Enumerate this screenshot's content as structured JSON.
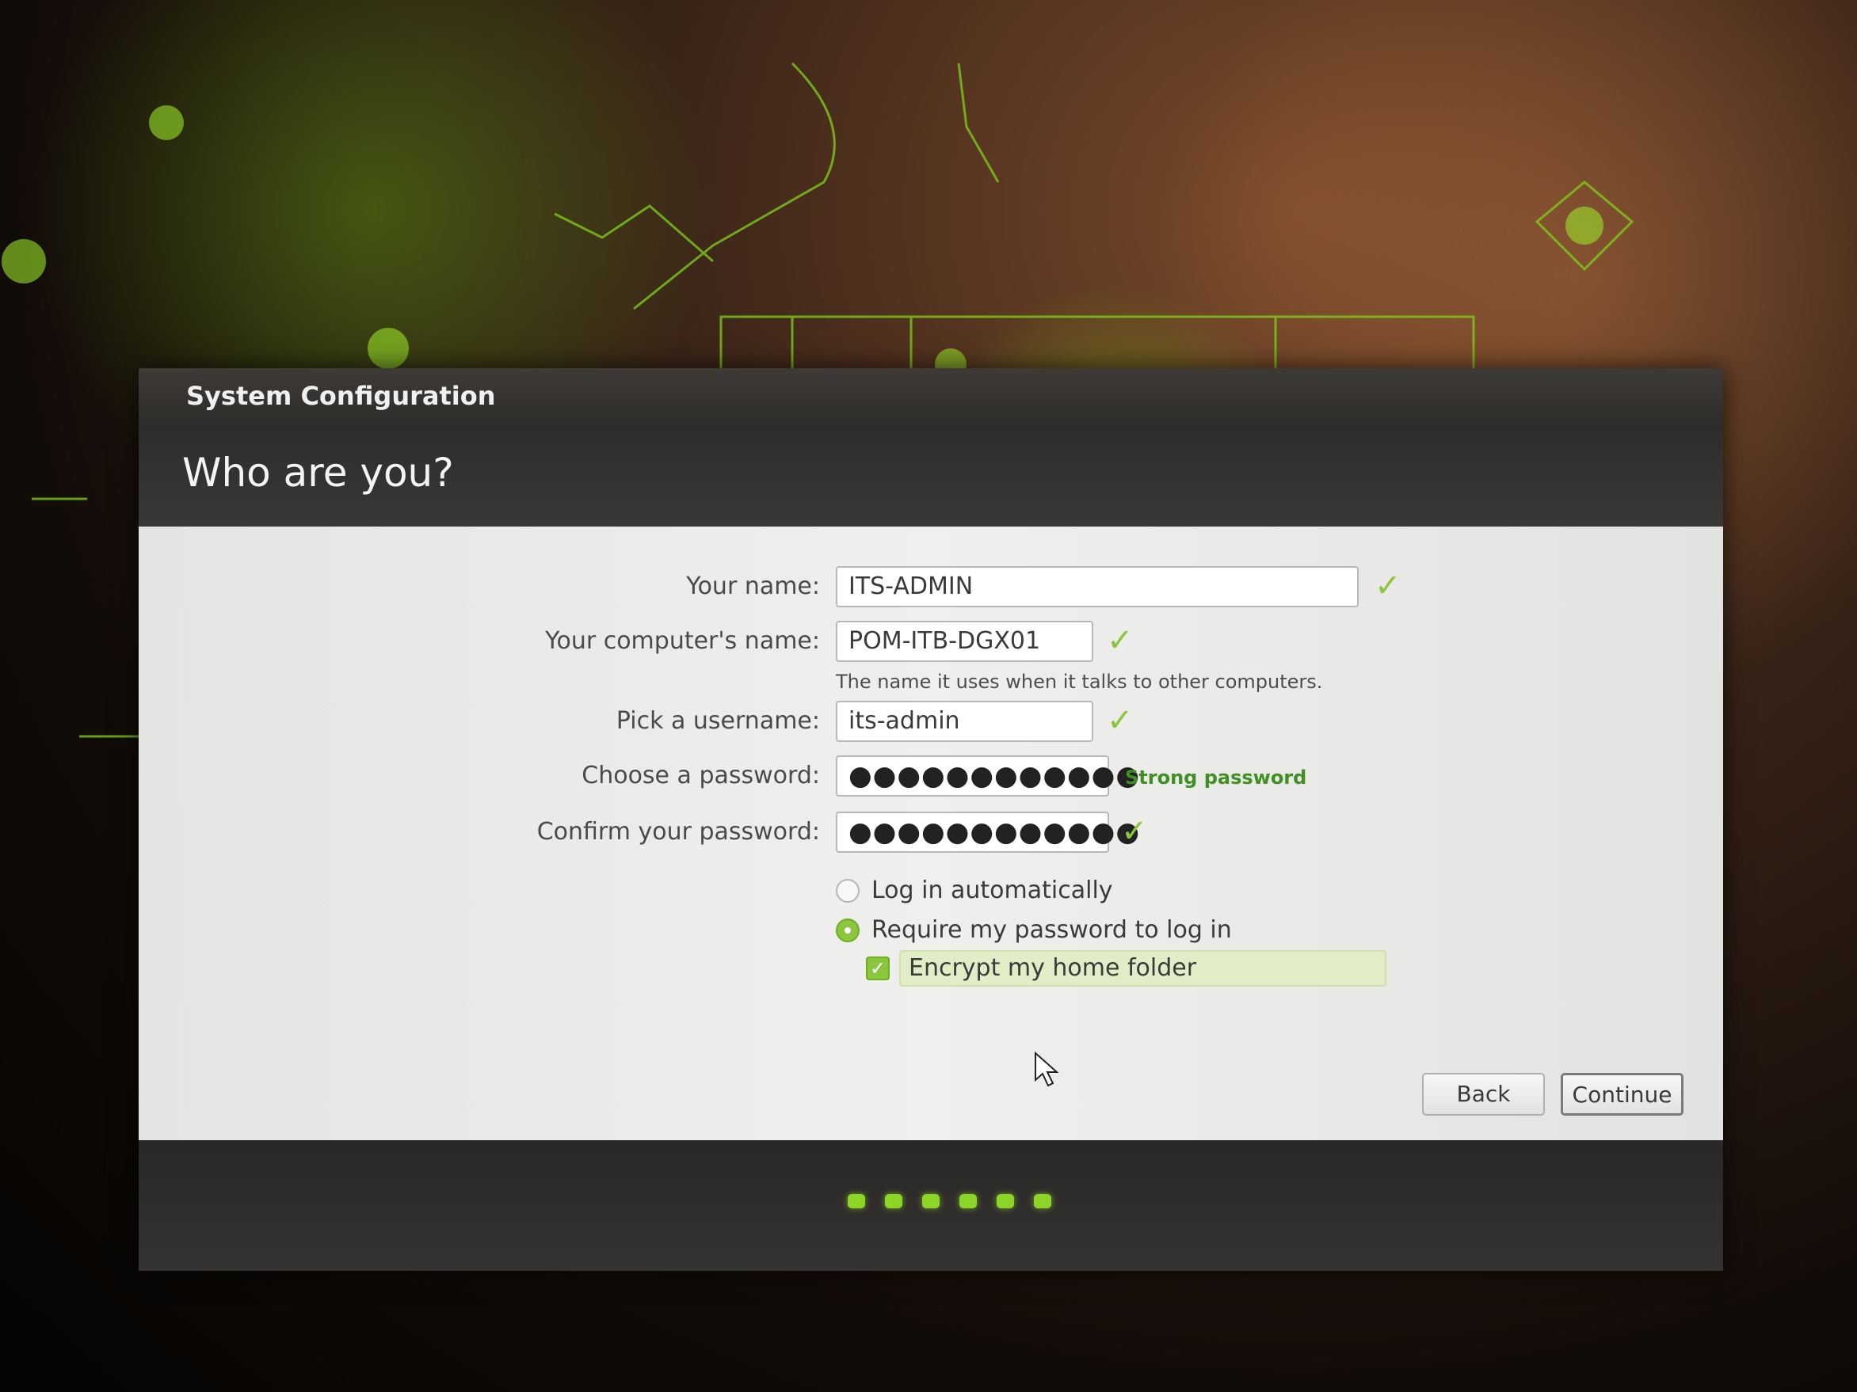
{
  "window": {
    "title": "System Configuration",
    "heading": "Who are you?"
  },
  "form": {
    "name_label": "Your name:",
    "name_value": "ITS-ADMIN",
    "computer_label": "Your computer's name:",
    "computer_value": "POM-ITB-DGX01",
    "computer_hint": "The name it uses when it talks to other computers.",
    "username_label": "Pick a username:",
    "username_value": "its-admin",
    "password_label": "Choose a password:",
    "password_value": "●●●●●●●●●●●●",
    "password_strength": "Strong password",
    "confirm_label": "Confirm your password:",
    "confirm_value": "●●●●●●●●●●●●"
  },
  "login_options": {
    "auto_login_label": "Log in automatically",
    "auto_login_selected": false,
    "require_password_label": "Require my password to log in",
    "require_password_selected": true,
    "encrypt_home_label": "Encrypt my home folder",
    "encrypt_home_checked": true
  },
  "buttons": {
    "back": "Back",
    "continue": "Continue"
  },
  "progress": {
    "total_steps": 6
  },
  "colors": {
    "accent": "#8cc63f",
    "strength": "#3f8f22",
    "header_bg": "#2e2c2a",
    "content_bg": "#ececea"
  },
  "icons": {
    "valid": "check-icon",
    "cursor": "mouse-pointer-icon"
  }
}
